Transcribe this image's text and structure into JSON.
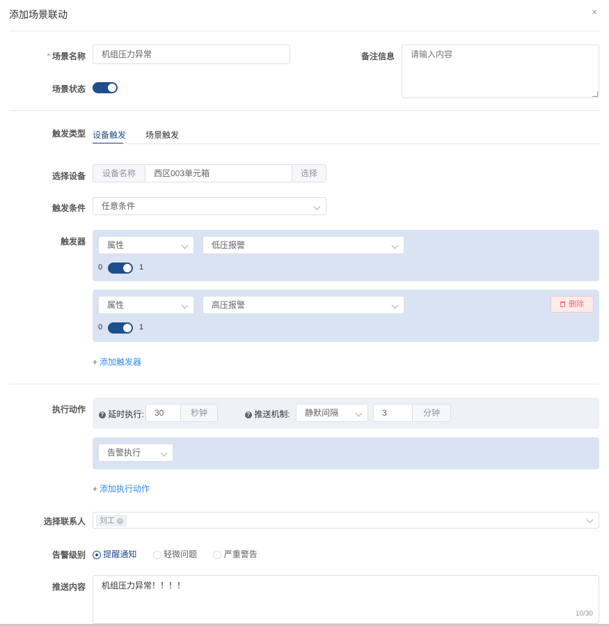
{
  "dialog": {
    "title": "添加场景联动",
    "close_icon": "×"
  },
  "basic": {
    "name_label": "场景名称",
    "name_value": "机组压力异常",
    "status_label": "场景状态",
    "remark_label": "备注信息",
    "remark_placeholder": "请输入内容",
    "status_on": true
  },
  "trigger": {
    "type_label": "触发类型",
    "tabs": [
      {
        "label": "设备触发",
        "active": true
      },
      {
        "label": "场景触发",
        "active": false
      }
    ],
    "device_label": "选择设备",
    "device_prefix": "设备名称",
    "device_value": "西区003单元箱",
    "device_button": "选择",
    "condition_label": "触发条件",
    "condition_value": "任意条件",
    "triggers_label": "触发器",
    "triggers": [
      {
        "kind": "属性",
        "alarm": "低压报警",
        "low": "0",
        "high": "1"
      },
      {
        "kind": "属性",
        "alarm": "高压报警",
        "low": "0",
        "high": "1",
        "delete_label": "删除"
      }
    ],
    "add_trigger": "添加触发器"
  },
  "action": {
    "label": "执行动作",
    "delay_label": "延时执行:",
    "delay_value": "30",
    "delay_unit": "秒钟",
    "push_label": "推送机制:",
    "push_mode": "静默间隔",
    "push_value": "3",
    "push_unit": "分钟",
    "action_select": "告警执行",
    "add_action": "添加执行动作"
  },
  "contacts": {
    "label": "选择联系人",
    "tags": [
      "刘工"
    ]
  },
  "level": {
    "label": "告警级别",
    "options": [
      {
        "label": "提醒通知",
        "checked": true
      },
      {
        "label": "轻微问题",
        "checked": false
      },
      {
        "label": "严重警告",
        "checked": false
      }
    ]
  },
  "push_content": {
    "label": "推送内容",
    "value": "机组压力异常！！！！",
    "counter": "10/30"
  },
  "colors": {
    "accent": "#1f4e8c",
    "link": "#2d8cf0",
    "danger": "#f56c6c",
    "panel": "#d9e3f3"
  }
}
